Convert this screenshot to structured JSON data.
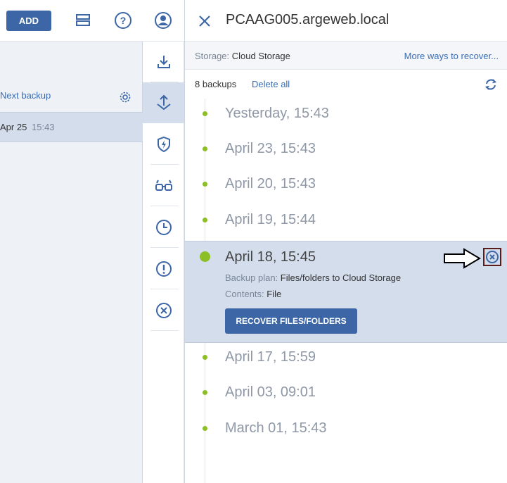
{
  "toolbar": {
    "add_label": "ADD"
  },
  "left_list": {
    "next_backup_label": "Next backup",
    "selected_row": {
      "date": "Apr 25",
      "time": "15:43"
    }
  },
  "panel": {
    "title": "PCAAG005.argeweb.local",
    "storage_label": "Storage:",
    "storage_value": "Cloud Storage",
    "more_ways": "More ways to recover...",
    "backup_count": "8 backups",
    "delete_all": "Delete all",
    "backups": [
      "Yesterday, 15:43",
      "April 23, 15:43",
      "April 20, 15:43",
      "April 19, 15:44",
      "April 18, 15:45",
      "April 17, 15:59",
      "April 03, 09:01",
      "March 01, 15:43"
    ],
    "selected": {
      "label": "April 18, 15:45",
      "plan_label": "Backup plan:",
      "plan_value": "Files/folders to Cloud Storage",
      "contents_label": "Contents:",
      "contents_value": "File",
      "recover_button": "RECOVER FILES/FOLDERS"
    }
  },
  "colors": {
    "accent": "#3c66a6",
    "link": "#3a6cb3",
    "timeline_dot": "#8cbf26",
    "selected_bg": "#d3ddec"
  },
  "icons": [
    "list-icon",
    "help-icon",
    "account-icon",
    "recover-icon",
    "backup-icon",
    "protect-icon",
    "glasses-icon",
    "clock-icon",
    "alert-icon",
    "cancel-icon",
    "close-icon",
    "gear-icon",
    "refresh-icon",
    "delete-backup-icon",
    "arrow-pointer-icon"
  ]
}
